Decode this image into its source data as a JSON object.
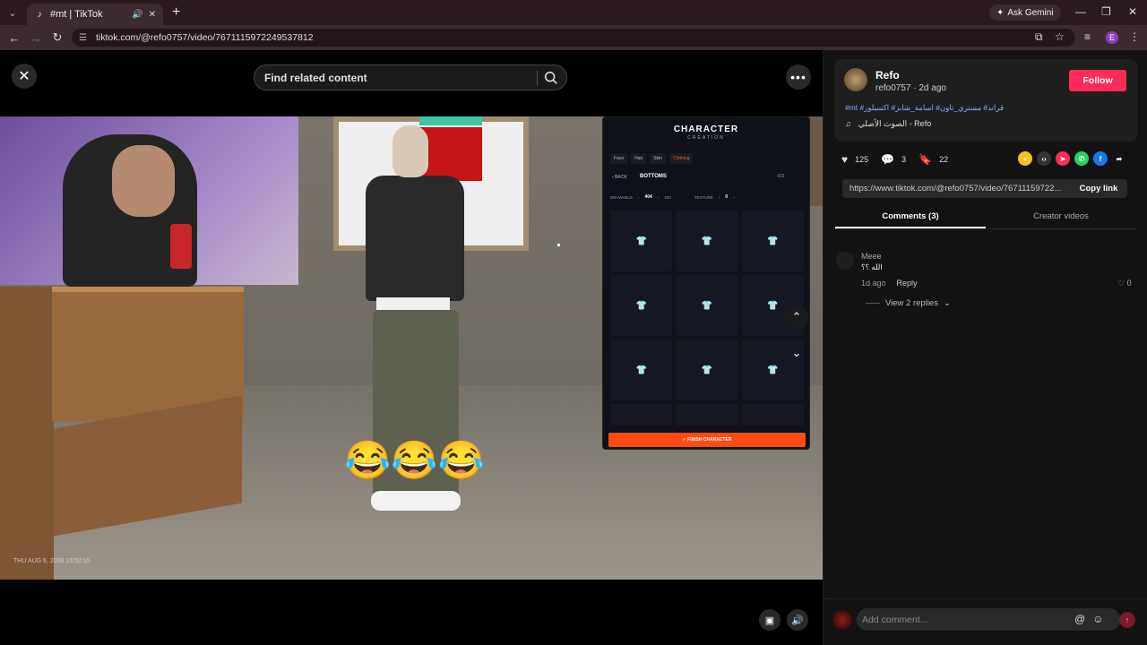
{
  "browser": {
    "tab_title": "#mt | TikTok",
    "url": "tiktok.com/@refo0757/video/7671115972249537812",
    "gemini_label": "Ask Gemini",
    "profile_initial": "E"
  },
  "video": {
    "search_placeholder": "Find related content",
    "timestamp": "THU AUG 6, 2026 15:52:15",
    "emojis": "😂😂😂",
    "character_panel": {
      "title": "CHARACTER",
      "subtitle": "CREATION",
      "tabs": [
        "Face",
        "Hair",
        "Skin",
        "Clothing"
      ],
      "back_label": "BACK",
      "section": "BOTTOMS",
      "count": "433",
      "drawable_label": "DRAWABLE",
      "drawable_value": "404",
      "drawable_max": "433",
      "texture_label": "TEXTURE",
      "texture_value": "0",
      "finish_label": "✓ FINISH CHARACTER"
    }
  },
  "post": {
    "author_name": "Refo",
    "author_handle": "refo0757",
    "posted": "2d ago",
    "follow_label": "Follow",
    "hashtags": "#mt #قراند# مستري_تاون# اسامة_شابز# اكسيلور",
    "sound": "الصوت الأصلي - Refo",
    "likes": "125",
    "comments": "3",
    "saves": "22",
    "link": "https://www.tiktok.com/@refo0757/video/76711159722...",
    "copy_label": "Copy link"
  },
  "tabs": {
    "comments": "Comments (3)",
    "creator": "Creator videos"
  },
  "comment": {
    "name": "Meee",
    "text": "الله ؟؟",
    "time": "1d ago",
    "reply": "Reply",
    "likes": "0",
    "view_replies": "View 2 replies"
  },
  "composer": {
    "placeholder": "Add comment..."
  }
}
